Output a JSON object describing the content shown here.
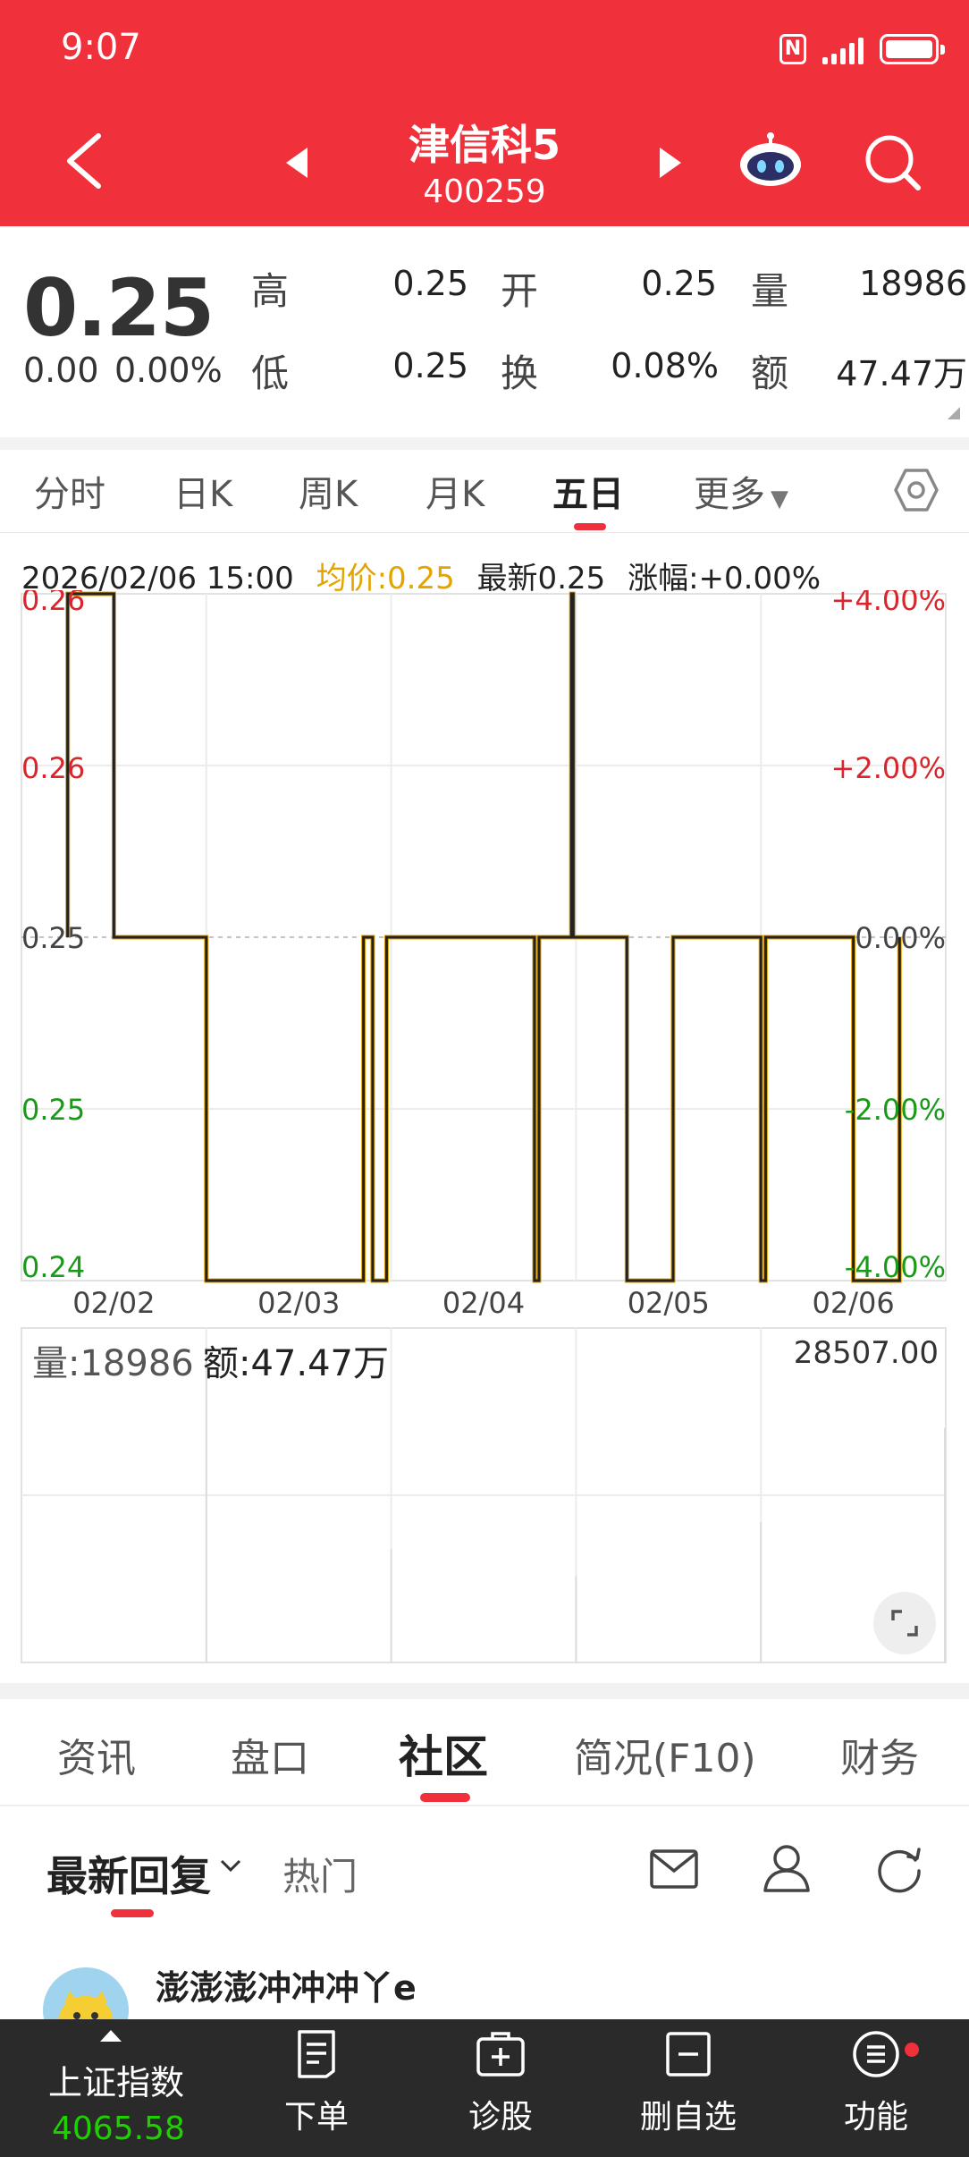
{
  "status_bar": {
    "time": "9:07"
  },
  "header": {
    "stock_name": "津信科5",
    "stock_code": "400259"
  },
  "quote": {
    "price": "0.25",
    "change": "0.00",
    "change_pct": "0.00%",
    "fields": [
      {
        "label": "高",
        "value": "0.25"
      },
      {
        "label": "开",
        "value": "0.25"
      },
      {
        "label": "量",
        "value": "18986"
      },
      {
        "label": "低",
        "value": "0.25"
      },
      {
        "label": "换",
        "value": "0.08%"
      },
      {
        "label": "额",
        "value": "47.47万"
      }
    ]
  },
  "chart_tabs": [
    "分时",
    "日K",
    "周K",
    "月K",
    "五日",
    "更多"
  ],
  "active_chart_tab": "五日",
  "info_line": {
    "datetime": "2026/02/06 15:00",
    "avg": "均价:0.25",
    "latest": "最新0.25",
    "change": "涨幅:+0.00%"
  },
  "colors": {
    "brand_red": "#f0303a",
    "up": "#d7262c",
    "down": "#1a9a1a",
    "avg_line": "#e4a400",
    "price_line": "#222222"
  },
  "chart_data": [
    {
      "type": "line",
      "title": "",
      "x_ticks": [
        "02/02",
        "02/03",
        "02/04",
        "02/05",
        "02/06"
      ],
      "y_left_ticks": [
        "0.26",
        "0.26",
        "0.25",
        "0.25",
        "0.24"
      ],
      "y_right_ticks": [
        "+4.00%",
        "+2.00%",
        "0.00%",
        "-2.00%",
        "-4.00%"
      ],
      "ylim": [
        0.24,
        0.26
      ],
      "reference_price": 0.25,
      "series": [
        {
          "values": [
            [
              0.05,
              0.25
            ],
            [
              0.05,
              0.26
            ],
            [
              0.1,
              0.26
            ],
            [
              0.1,
              0.25
            ],
            [
              0.2,
              0.25
            ],
            [
              0.2,
              0.24
            ],
            [
              0.37,
              0.24
            ],
            [
              0.37,
              0.25
            ],
            [
              0.38,
              0.25
            ],
            [
              0.38,
              0.24
            ],
            [
              0.395,
              0.24
            ],
            [
              0.395,
              0.25
            ],
            [
              0.555,
              0.25
            ],
            [
              0.555,
              0.24
            ],
            [
              0.56,
              0.24
            ],
            [
              0.56,
              0.25
            ],
            [
              0.595,
              0.25
            ],
            [
              0.595,
              0.26
            ],
            [
              0.597,
              0.26
            ],
            [
              0.597,
              0.25
            ],
            [
              0.655,
              0.25
            ],
            [
              0.655,
              0.24
            ],
            [
              0.705,
              0.24
            ],
            [
              0.705,
              0.25
            ],
            [
              0.8,
              0.25
            ],
            [
              0.8,
              0.24
            ],
            [
              0.805,
              0.24
            ],
            [
              0.805,
              0.25
            ],
            [
              0.9,
              0.25
            ],
            [
              0.9,
              0.24
            ],
            [
              0.95,
              0.24
            ],
            [
              0.95,
              0.25
            ]
          ]
        }
      ]
    },
    {
      "type": "bar",
      "title": "量:18986 额:47.47万",
      "max_label": "28507.00",
      "bars": [
        {
          "x": 0.2,
          "v": 0.94
        },
        {
          "x": 0.4,
          "v": 0.34
        },
        {
          "x": 0.6,
          "v": 0.26
        },
        {
          "x": 0.8,
          "v": 0.42
        },
        {
          "x": 0.999,
          "v": 0.7
        }
      ]
    }
  ],
  "volume": {
    "vol": "量:18986",
    "amount": "额:47.47万",
    "max": "28507.00"
  },
  "info_tabs": [
    "资讯",
    "盘口",
    "社区",
    "简况(F10)",
    "财务"
  ],
  "community": {
    "sort_label": "最新回复",
    "hot_label": "热门",
    "post_author": "澎澎澎冲冲冲丫e"
  },
  "bottom_nav": {
    "index_name": "上证指数",
    "index_value": "4065.58",
    "items": [
      "下单",
      "诊股",
      "删自选",
      "功能"
    ]
  }
}
